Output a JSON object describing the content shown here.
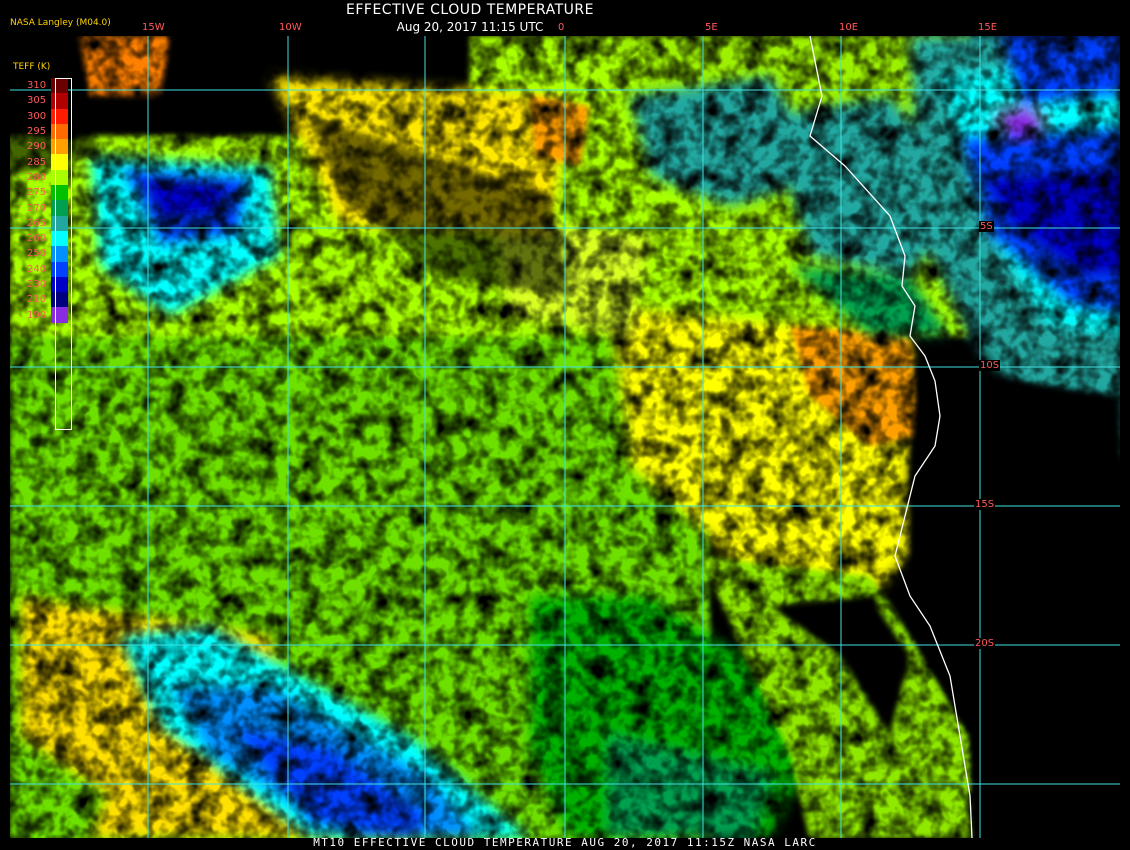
{
  "header": {
    "title": "EFFECTIVE CLOUD TEMPERATURE",
    "timestamp": "Aug 20, 2017 11:15 UTC",
    "provider": "NASA Langley (M04.0)"
  },
  "footer": {
    "text": "MT10  EFFECTIVE CLOUD TEMPERATURE   AUG 20, 2017 11:15Z  NASA LARC"
  },
  "legend": {
    "title": "TEFF (K)",
    "entries": [
      {
        "label": "310",
        "color": "#6b0000"
      },
      {
        "label": "305",
        "color": "#b00000"
      },
      {
        "label": "300",
        "color": "#ff1a00"
      },
      {
        "label": "295",
        "color": "#ff6a00"
      },
      {
        "label": "290",
        "color": "#ffa000"
      },
      {
        "label": "285",
        "color": "#ffff00"
      },
      {
        "label": "280",
        "color": "#a8ff00"
      },
      {
        "label": "275",
        "color": "#00c000"
      },
      {
        "label": "270",
        "color": "#00a050"
      },
      {
        "label": "265",
        "color": "#20a8a0"
      },
      {
        "label": "260",
        "color": "#00ffff"
      },
      {
        "label": "250",
        "color": "#0090ff"
      },
      {
        "label": "240",
        "color": "#0040ff"
      },
      {
        "label": "230",
        "color": "#0000c8"
      },
      {
        "label": "210",
        "color": "#000080"
      },
      {
        "label": "190",
        "color": "#8a2be2"
      }
    ]
  },
  "grid": {
    "longitudes": [
      "15W",
      "10W",
      "0",
      "5E",
      "10E",
      "15E"
    ],
    "latitudes": [
      "5S",
      "10S",
      "15S",
      "20S"
    ],
    "grid_color": "#40e0e0"
  },
  "colors": {
    "background": "#000000",
    "coastline": "#ffffff"
  }
}
